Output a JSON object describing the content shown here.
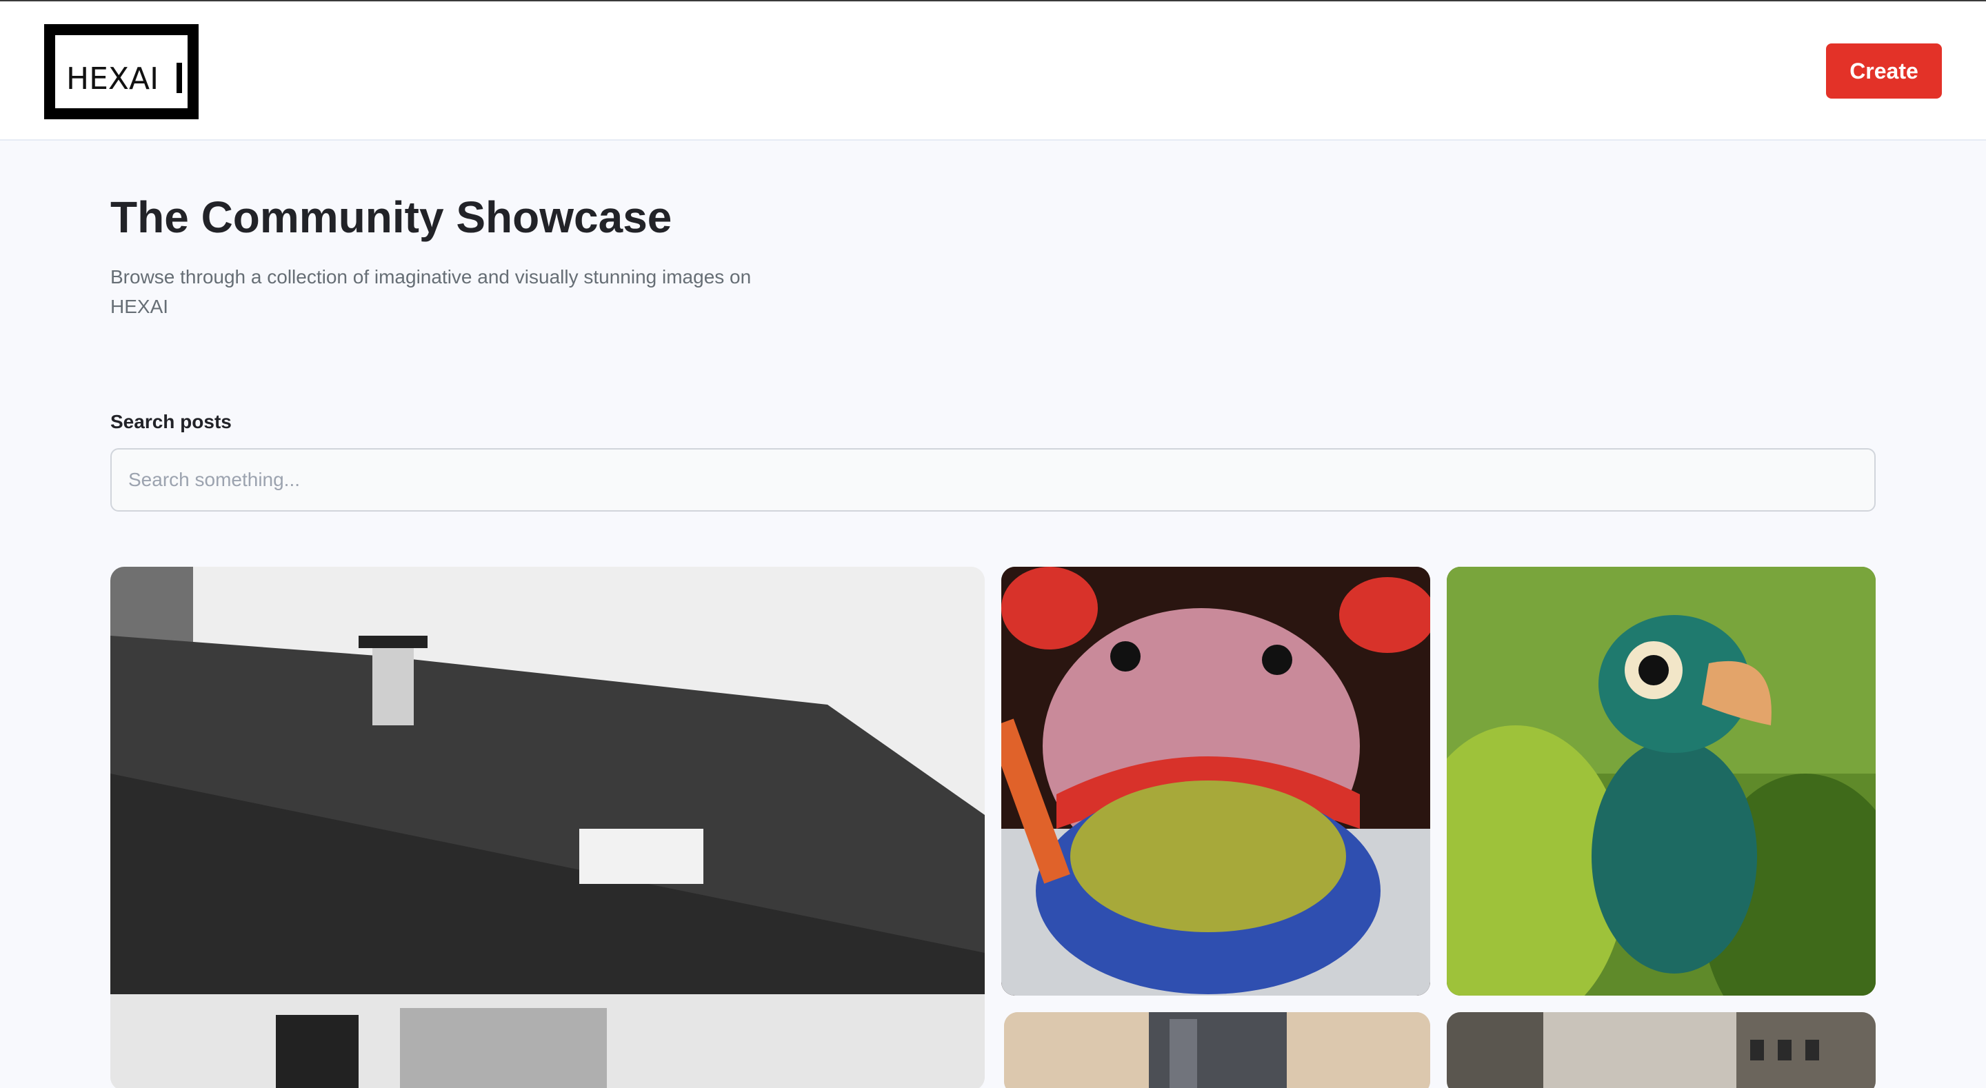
{
  "header": {
    "logo_text": "HEXAI",
    "create_label": "Create"
  },
  "hero": {
    "title": "The Community Showcase",
    "subtitle": "Browse through a collection of imaginative and visually stunning images on HEXAI"
  },
  "search": {
    "label": "Search posts",
    "placeholder": "Search something..."
  },
  "gallery": {
    "images": [
      {
        "subject": "black-and-white house roof"
      },
      {
        "subject": "knitted monster eating yarn in a cup"
      },
      {
        "subject": "green parrot-like creature in jungle"
      },
      {
        "subject": "top hat portrait"
      },
      {
        "subject": "city street building"
      }
    ]
  },
  "colors": {
    "accent": "#e33228",
    "background": "#f8f9fd"
  }
}
